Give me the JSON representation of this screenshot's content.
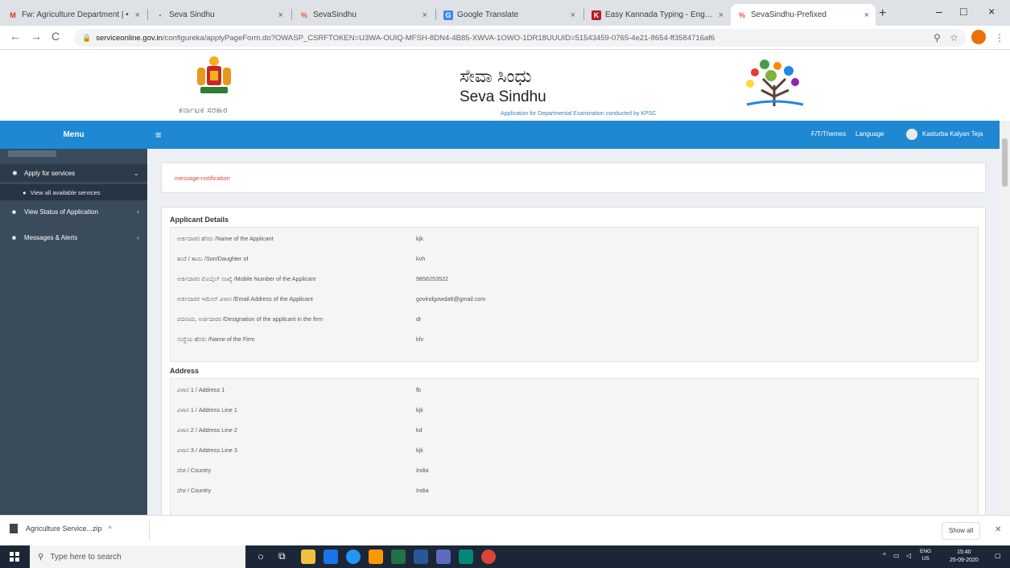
{
  "browser": {
    "tabs": [
      {
        "title": "Fw: Agriculture Department | •",
        "favicon": "gmail-icon",
        "active": false
      },
      {
        "title": "Seva Sindhu",
        "favicon": "page-icon",
        "active": false
      },
      {
        "title": "SevaSindhu",
        "favicon": "sevasindhu-icon",
        "active": false
      },
      {
        "title": "Google Translate",
        "favicon": "translate-icon",
        "active": false
      },
      {
        "title": "Easy Kannada Typing - English",
        "favicon": "kannada-icon",
        "active": false
      },
      {
        "title": "SevaSindhu-Prefixed",
        "favicon": "sevasindhu-icon",
        "active": true
      }
    ],
    "url_host": "serviceonline.gov.in",
    "url_path": "/configureka/applyPageForm.do?OWASP_CSRFTOKEN=U3WA-OUIQ-MFSH-8DN4-4B85-XWVA-1OWO-1DR18UUUID=51543459-0765-4e21-8654-ff3584716af6"
  },
  "site": {
    "emblem_caption": "ಕರ್ನಾಟಕ ಸರಕಾರ",
    "title_kn": "ಸೇವಾ ಸಿಂಧು",
    "title_en": "Seva Sindhu",
    "subtitle": "Application for Departmental Examination conducted by KPSC"
  },
  "sidebar": {
    "menu_label": "Menu",
    "items": [
      {
        "label": "Apply for services",
        "icon": "gear-icon"
      },
      {
        "label": "View all available services",
        "icon": "circle-icon"
      },
      {
        "label": "View Status of Application",
        "icon": "square-icon"
      },
      {
        "label": "Messages & Alerts",
        "icon": "square-icon"
      }
    ]
  },
  "topbar": {
    "themes": "F/T/Themes",
    "language": "Language",
    "user": "Kasturba Kalyan Teja"
  },
  "content": {
    "message": "message-notification",
    "applicant_heading": "Applicant Details",
    "applicant_rows": [
      {
        "label": "ಅರ್ಜಿದಾರರ ಹೆಸರು /Name of the Applicant",
        "value": "kjk"
      },
      {
        "label": "ತಂದೆ / ತಾಯಿ /Son/Daughter of",
        "value": "kvh"
      },
      {
        "label": "ಅರ್ಜಿದಾರರ ಮೊಬೈಲ್ ಸಂಖ್ಯೆ /Mobile Number of the Applicant",
        "value": "9856253522"
      },
      {
        "label": "ಅರ್ಜಿದಾರರ ಇಮೇಲ್ ವಿಳಾಸ /Email Address of the Applicant",
        "value": "govindgowda6@gmail.com"
      },
      {
        "label": "ಪದನಾಮ, ಅರ್ಜಿದಾರರ /Designation of the applicant in the firm",
        "value": "dr"
      },
      {
        "label": "ಸಂಸ್ಥೆಯ ಹೆಸರು /Name of the Firm",
        "value": "kfv"
      }
    ],
    "address_heading": "Address",
    "address_rows": [
      {
        "label": "ವಿಳಾಸ 1 / Address 1",
        "value": "fb"
      },
      {
        "label": "ವಿಳಾಸ 1 / Address Line 1",
        "value": "kjk"
      },
      {
        "label": "ವಿಳಾಸ 2 / Address Line 2",
        "value": "kd"
      },
      {
        "label": "ವಿಳಾಸ 3 / Address Line 3",
        "value": "kjk"
      },
      {
        "label": "ದೇಶ / Country",
        "value": "India"
      },
      {
        "label": "ದೇಶ / Country",
        "value": "India"
      }
    ]
  },
  "download": {
    "file": "Agriculture Service...zip",
    "show_all": "Show all"
  },
  "taskbar": {
    "search_placeholder": "Type here to search",
    "lang1": "ENG",
    "lang2": "US",
    "time": "15:40",
    "date": "25-09-2020"
  },
  "colors": {
    "brand_blue": "#1e88d2",
    "sidebar": "#3a4b5c",
    "error_red": "#dd4b39"
  }
}
